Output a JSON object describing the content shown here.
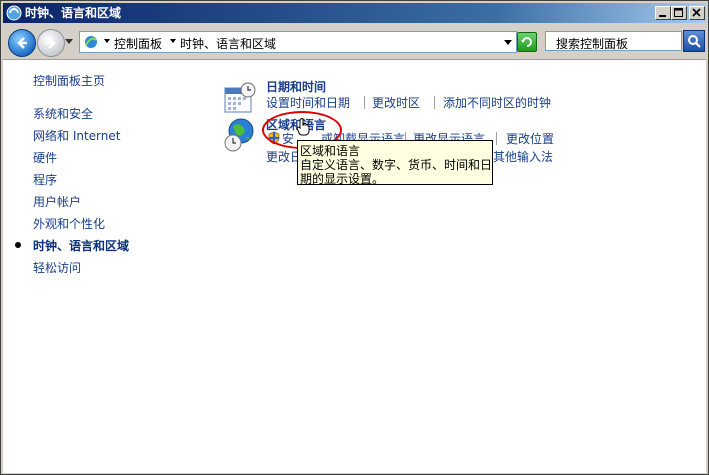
{
  "window": {
    "title": "时钟、语言和区域",
    "icon": "control-panel-icon"
  },
  "address": {
    "breadcrumb": [
      "控制面板",
      "时钟、语言和区域"
    ],
    "search_placeholder": "搜索控制面板"
  },
  "sidebar": {
    "home": "控制面板主页",
    "items": [
      {
        "label": "系统和安全"
      },
      {
        "label": "网络和 Internet"
      },
      {
        "label": "硬件"
      },
      {
        "label": "程序"
      },
      {
        "label": "用户帐户"
      },
      {
        "label": "外观和个性化"
      },
      {
        "label": "时钟、语言和区域",
        "current": true
      },
      {
        "label": "轻松访问"
      }
    ]
  },
  "categories": {
    "datetime": {
      "title": "日期和时间",
      "links": [
        "设置时间和日期",
        "更改时区",
        "添加不同时区的时钟"
      ]
    },
    "region": {
      "title": "区域和语言",
      "links": [
        "安装或卸载显示语言",
        "更改显示语言",
        "更改位置",
        "更改日期、时间或数字格式",
        "其他输入法"
      ],
      "visible_fragments": {
        "install_prefix": "安",
        "install_suffix": "或卸载显示语言",
        "format_prefix": "更改日",
        "other_input": "其他输入法"
      }
    }
  },
  "tooltip": {
    "line1": "区域和语言",
    "line2": "自定义语言、数字、货币、时间和日",
    "line3": "期的显示设置。"
  },
  "colors": {
    "link": "#1a3e8c",
    "titlebar_start": "#0a246a",
    "highlight_circle": "#e00000",
    "tooltip_bg": "#ffffe1"
  }
}
